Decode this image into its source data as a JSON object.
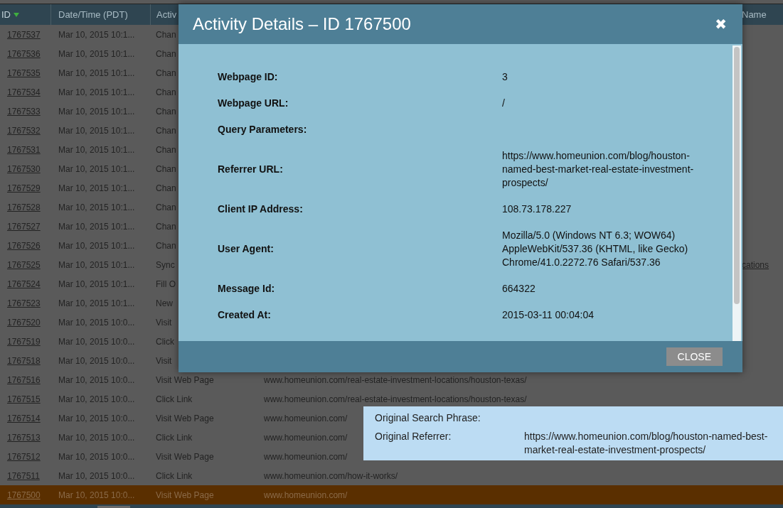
{
  "table": {
    "columns": [
      {
        "label": "ID",
        "sorted": true
      },
      {
        "label": "Date/Time (PDT)",
        "sorted": false
      },
      {
        "label": "Activ",
        "sorted": false
      },
      {
        "label": "Name",
        "sorted": false
      }
    ],
    "rows": [
      {
        "id": "1767537",
        "date": "Mar 10, 2015 10:1...",
        "activity": "Chan",
        "selected": false
      },
      {
        "id": "1767536",
        "date": "Mar 10, 2015 10:1...",
        "activity": "Chan",
        "selected": false
      },
      {
        "id": "1767535",
        "date": "Mar 10, 2015 10:1...",
        "activity": "Chan",
        "selected": false
      },
      {
        "id": "1767534",
        "date": "Mar 10, 2015 10:1...",
        "activity": "Chan",
        "selected": false
      },
      {
        "id": "1767533",
        "date": "Mar 10, 2015 10:1...",
        "activity": "Chan",
        "selected": false
      },
      {
        "id": "1767532",
        "date": "Mar 10, 2015 10:1...",
        "activity": "Chan",
        "selected": false
      },
      {
        "id": "1767531",
        "date": "Mar 10, 2015 10:1...",
        "activity": "Chan",
        "selected": false
      },
      {
        "id": "1767530",
        "date": "Mar 10, 2015 10:1...",
        "activity": "Chan",
        "selected": false
      },
      {
        "id": "1767529",
        "date": "Mar 10, 2015 10:1...",
        "activity": "Chan",
        "selected": false
      },
      {
        "id": "1767528",
        "date": "Mar 10, 2015 10:1...",
        "activity": "Chan",
        "selected": false
      },
      {
        "id": "1767527",
        "date": "Mar 10, 2015 10:1...",
        "activity": "Chan",
        "selected": false
      },
      {
        "id": "1767526",
        "date": "Mar 10, 2015 10:1...",
        "activity": "Chan",
        "selected": false
      },
      {
        "id": "1767525",
        "date": "Mar 10, 2015 10:1...",
        "activity": "Sync",
        "column_5": "cations",
        "selected": false
      },
      {
        "id": "1767524",
        "date": "Mar 10, 2015 10:1...",
        "activity": "Fill O",
        "selected": false
      },
      {
        "id": "1767523",
        "date": "Mar 10, 2015 10:1...",
        "activity": "New",
        "selected": false
      },
      {
        "id": "1767520",
        "date": "Mar 10, 2015 10:0...",
        "activity": "Visit",
        "selected": false
      },
      {
        "id": "1767519",
        "date": "Mar 10, 2015 10:0...",
        "activity": "Click",
        "selected": false
      },
      {
        "id": "1767518",
        "date": "Mar 10, 2015 10:0...",
        "activity": "Visit",
        "selected": false
      },
      {
        "id": "1767516",
        "date": "Mar 10, 2015 10:0...",
        "activity": "Visit Web Page",
        "detail": "www.homeunion.com/real-estate-investment-locations/houston-texas/",
        "selected": false
      },
      {
        "id": "1767515",
        "date": "Mar 10, 2015 10:0...",
        "activity": "Click Link",
        "detail": "www.homeunion.com/real-estate-investment-locations/houston-texas/",
        "selected": false
      },
      {
        "id": "1767514",
        "date": "Mar 10, 2015 10:0...",
        "activity": "Visit Web Page",
        "detail": "www.homeunion.com/",
        "selected": false
      },
      {
        "id": "1767513",
        "date": "Mar 10, 2015 10:0...",
        "activity": "Click Link",
        "detail": "www.homeunion.com/",
        "selected": false
      },
      {
        "id": "1767512",
        "date": "Mar 10, 2015 10:0...",
        "activity": "Visit Web Page",
        "detail": "www.homeunion.com/",
        "selected": false
      },
      {
        "id": "1767511",
        "date": "Mar 10, 2015 10:0...",
        "activity": "Click Link",
        "detail": "www.homeunion.com/how-it-works/",
        "selected": false
      },
      {
        "id": "1767500",
        "date": "Mar 10, 2015 10:0...",
        "activity": "Visit Web Page",
        "detail": "www.homeunion.com/",
        "selected": true
      }
    ]
  },
  "dialog": {
    "title": "Activity Details – ID 1767500",
    "close_icon": "✖",
    "fields": [
      {
        "label": "Webpage ID:",
        "value": "3"
      },
      {
        "label": "Webpage URL:",
        "value": "/"
      },
      {
        "label": "Query Parameters:"
      },
      {
        "label": "Referrer URL:",
        "value": "https://www.homeunion.com/blog/houston-named-best-market-real-estate-investment-prospects/"
      },
      {
        "label": "Client IP Address:",
        "value": "108.73.178.227"
      },
      {
        "label": "User Agent:",
        "value": "Mozilla/5.0 (Windows NT 6.3; WOW64) AppleWebKit/537.36 (KHTML, like Gecko) Chrome/41.0.2272.76 Safari/537.36"
      },
      {
        "label": "Message Id:",
        "value": "664322"
      },
      {
        "label": "Created At:",
        "value": "2015-03-11 00:04:04"
      }
    ],
    "button": "CLOSE"
  },
  "tooltip": {
    "fields": [
      {
        "label": "Original Search Phrase:"
      },
      {
        "label": "Original Referrer:",
        "value": "https://www.homeunion.com/blog/houston-named-best-market-real-estate-investment-prospects/"
      }
    ]
  }
}
